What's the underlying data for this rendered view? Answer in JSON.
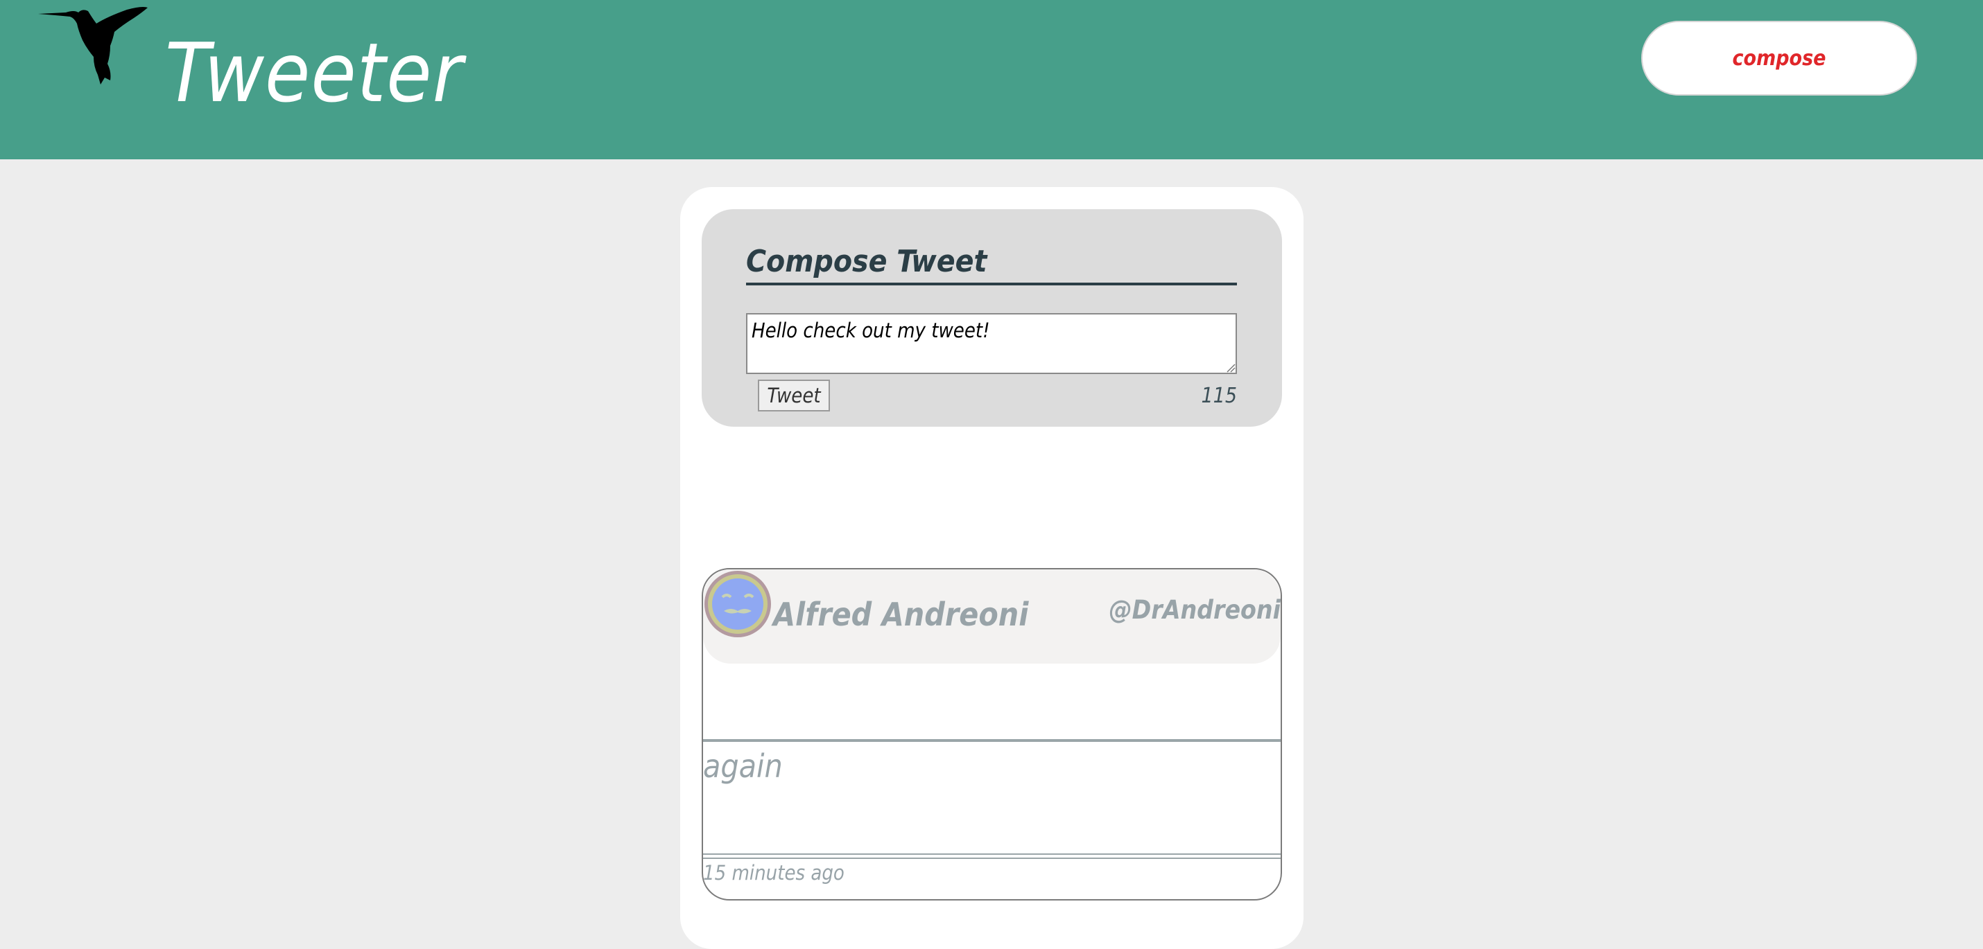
{
  "header": {
    "brand": "Tweeter",
    "compose_label": "compose",
    "logo_icon": "hummingbird-icon",
    "background_color": "#479f8a",
    "compose_text_color": "#e0262a"
  },
  "compose": {
    "title": "Compose Tweet",
    "input_value": "Hello check out my tweet!",
    "tweet_button_label": "Tweet",
    "char_counter": "115"
  },
  "tweets": [
    {
      "avatar_icon": "avatar-face-icon",
      "name": "Alfred Andreoni",
      "handle": "@DrAndreoni",
      "text": "again",
      "timestamp": "15 minutes ago"
    }
  ]
}
